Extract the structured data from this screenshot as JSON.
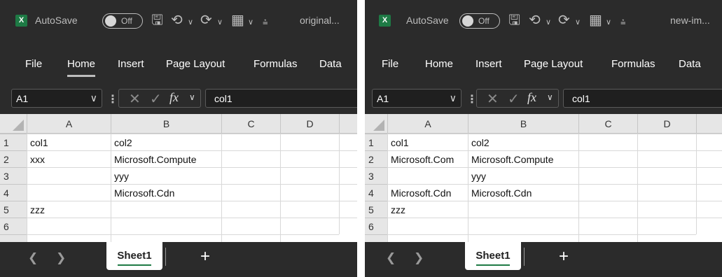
{
  "windows": [
    {
      "filename": "original...",
      "app_icon": "excel-logo",
      "logo_letter": "X",
      "autosave_label": "AutoSave",
      "autosave_state": "Off",
      "ribbon_tabs": [
        "File",
        "Home",
        "Insert",
        "Page Layout",
        "Formulas",
        "Data"
      ],
      "active_tab": "Home",
      "namebox": "A1",
      "formula": "col1",
      "fx": "fx",
      "columns": [
        "A",
        "B",
        "C",
        "D"
      ],
      "rows": [
        "1",
        "2",
        "3",
        "4",
        "5",
        "6"
      ],
      "cells": [
        [
          "col1",
          "col2",
          "",
          ""
        ],
        [
          "xxx",
          "Microsoft.Compute",
          "",
          ""
        ],
        [
          "",
          "yyy",
          "",
          ""
        ],
        [
          "",
          "Microsoft.Cdn",
          "",
          ""
        ],
        [
          "zzz",
          "",
          "",
          ""
        ],
        [
          "",
          "",
          "",
          ""
        ]
      ],
      "sheet_tab": "Sheet1",
      "add_sheet": "+"
    },
    {
      "filename": "new-im...",
      "app_icon": "excel-logo",
      "logo_letter": "X",
      "autosave_label": "AutoSave",
      "autosave_state": "Off",
      "ribbon_tabs": [
        "File",
        "Home",
        "Insert",
        "Page Layout",
        "Formulas",
        "Data"
      ],
      "active_tab": "",
      "namebox": "A1",
      "formula": "col1",
      "fx": "fx",
      "columns": [
        "A",
        "B",
        "C",
        "D"
      ],
      "rows": [
        "1",
        "2",
        "3",
        "4",
        "5",
        "6"
      ],
      "cells": [
        [
          "col1",
          "col2",
          "",
          ""
        ],
        [
          "Microsoft.Com",
          "Microsoft.Compute",
          "",
          ""
        ],
        [
          "",
          "yyy",
          "",
          ""
        ],
        [
          "Microsoft.Cdn",
          "Microsoft.Cdn",
          "",
          ""
        ],
        [
          "zzz",
          "",
          "",
          ""
        ],
        [
          "",
          "",
          "",
          ""
        ]
      ],
      "sheet_tab": "Sheet1",
      "add_sheet": "+"
    }
  ]
}
